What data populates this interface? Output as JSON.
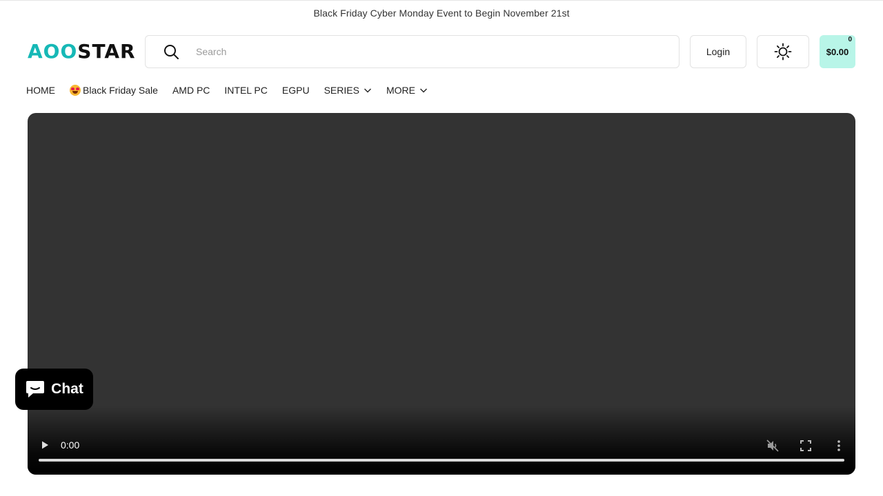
{
  "announcement": "Black Friday Cyber Monday Event to Begin November 21st",
  "header": {
    "logo_part1": "AOO",
    "logo_part2": "STAR",
    "search_placeholder": "Search",
    "login_label": "Login",
    "cart_total": "$0.00",
    "cart_count": "0"
  },
  "nav": {
    "home": "HOME",
    "black_friday": "Black Friday Sale",
    "amd_pc": "AMD PC",
    "intel_pc": "INTEL PC",
    "egpu": "EGPU",
    "series": "SERIES",
    "more": "MORE"
  },
  "video": {
    "time": "0:00",
    "progress": 0
  },
  "chat": {
    "label": "Chat"
  },
  "colors": {
    "brand_teal": "#16b8b6",
    "cart_bg": "#b8f5e8",
    "video_bg": "#333333"
  },
  "icons": [
    "search-icon",
    "sun-icon",
    "chevron-down-icon",
    "play-icon",
    "mute-icon",
    "fullscreen-icon",
    "more-vert-icon",
    "chat-bubble-icon",
    "star-eyes-emoji-icon"
  ]
}
